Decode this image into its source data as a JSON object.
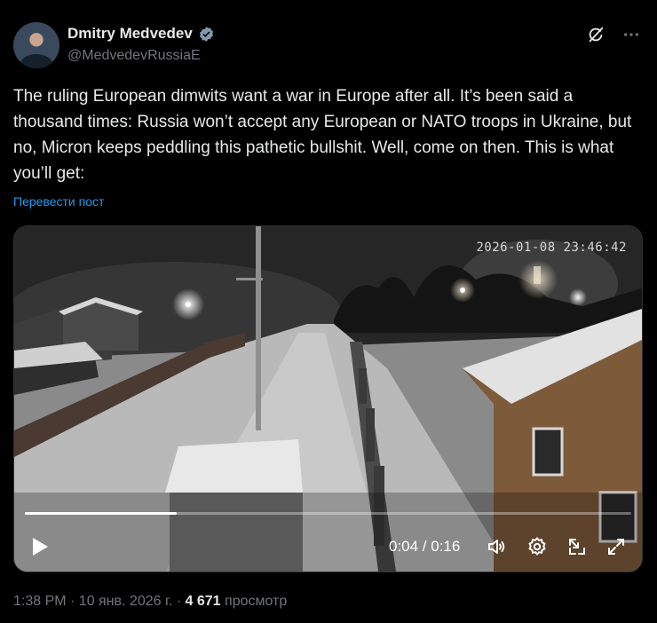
{
  "author": {
    "name": "Dmitry Medvedev",
    "handle": "@MedvedevRussiaE",
    "verified": true
  },
  "tweet": {
    "text": "The ruling European dimwits want a war in Europe after all. It’s been said a thousand times: Russia won’t accept any European or NATO troops in Ukraine, but no, Micron keeps peddling this pathetic bullshit. Well, come on then. This is what you’ll get:",
    "translate_label": "Перевести пост"
  },
  "video": {
    "overlay_timestamp": "2026-01-08 23:46:42",
    "time_readout": "0:04 / 0:16",
    "progress": 0.25
  },
  "meta": {
    "time": "1:38 PM · 10 янв. 2026 г. ·",
    "views_count": "4 671",
    "views_label": "просмотр"
  },
  "colors": {
    "accent": "#1d9bf0",
    "verified_badge": "#829aab",
    "text_primary": "#e7e9ea",
    "text_secondary": "#71767b"
  }
}
